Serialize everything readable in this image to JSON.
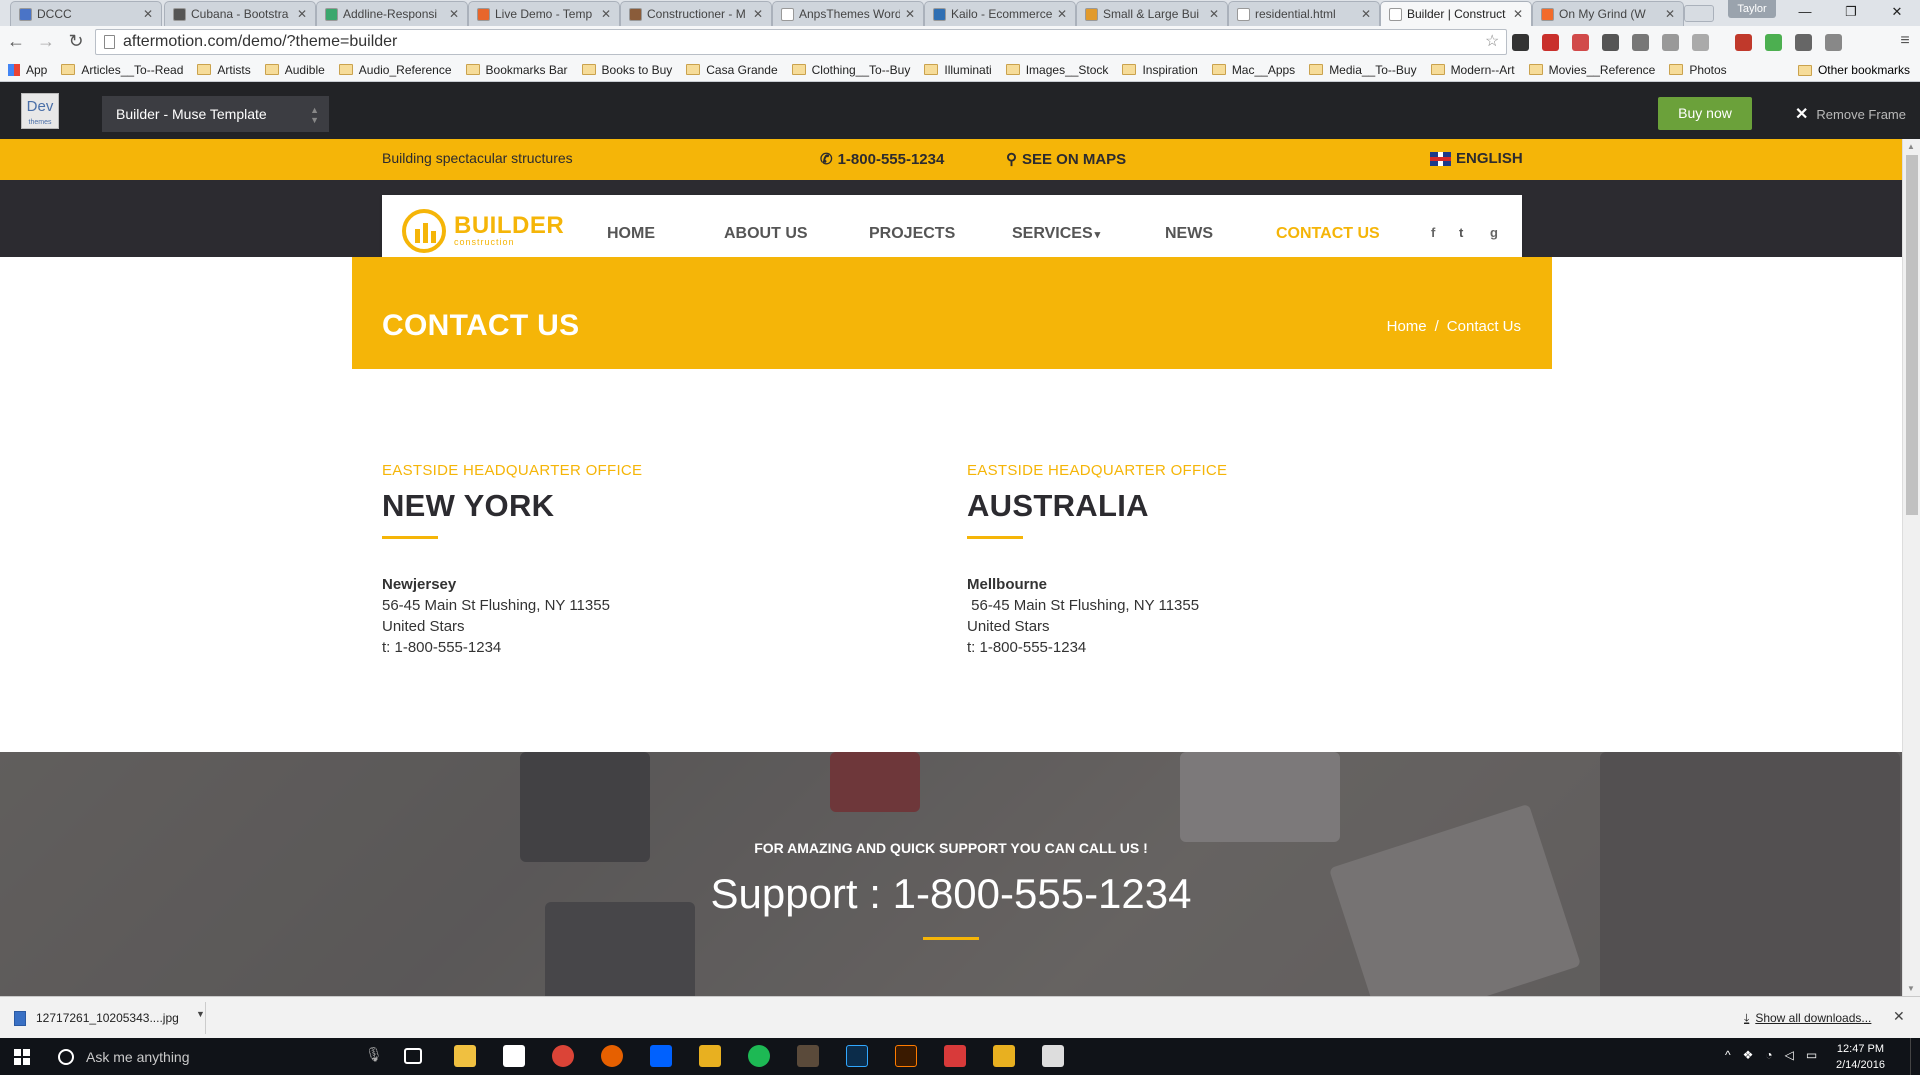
{
  "browser": {
    "tabs": [
      {
        "title": "DCCC",
        "color": "#4a74c7"
      },
      {
        "title": "Cubana - Bootstra",
        "color": "#555555"
      },
      {
        "title": "Addline-Responsi",
        "color": "#3aa76d"
      },
      {
        "title": "Live Demo - Temp",
        "color": "#e8662b"
      },
      {
        "title": "Constructioner - M",
        "color": "#8a5c3a"
      },
      {
        "title": "AnpsThemes Word",
        "color": "#ffffff"
      },
      {
        "title": "Kailo - Ecommerce",
        "color": "#2f6fb3"
      },
      {
        "title": "Small & Large Bui",
        "color": "#e19a2c"
      },
      {
        "title": "residential.html",
        "color": "#ffffff"
      },
      {
        "title": "Builder | Construct",
        "color": "#ffffff"
      },
      {
        "title": "On My Grind (W",
        "color": "#f26b2a"
      }
    ],
    "user": "Taylor",
    "url": "aftermotion.com/demo/?theme=builder",
    "bookmarks": [
      "App",
      "Articles__To--Read",
      "Artists",
      "Audible",
      "Audio_Reference",
      "Bookmarks Bar",
      "Books to Buy",
      "Casa Grande",
      "Clothing__To--Buy",
      "Illuminati",
      "Images__Stock",
      "Inspiration",
      "Mac__Apps",
      "Media__To--Buy",
      "Modern--Art",
      "Movies__Reference",
      "Photos"
    ],
    "other_bookmarks": "Other bookmarks"
  },
  "framebar": {
    "logo_text": "Dev",
    "logo_sub": "themes",
    "theme_select": "Builder - Muse Template",
    "buy_now": "Buy now",
    "remove_frame": "Remove Frame"
  },
  "site": {
    "topstrip": {
      "tagline": "Building spectacular structures",
      "phone": "1-800-555-1234",
      "maps": "SEE ON MAPS",
      "language": "ENGLISH"
    },
    "logo": {
      "name": "BUILDER",
      "sub": "construction"
    },
    "menu": [
      "HOME",
      "ABOUT US",
      "PROJECTS",
      "SERVICES",
      "NEWS",
      "CONTACT US"
    ],
    "services_caret": "▾",
    "social": [
      "f",
      "t",
      "g"
    ],
    "page_title": "CONTACT US",
    "breadcrumb": {
      "home": "Home",
      "sep": "/",
      "current": "Contact Us"
    },
    "offices": [
      {
        "kicker": "EASTSIDE HEADQUARTER OFFICE",
        "city": "NEW YORK",
        "name": "Newjersey",
        "street": "56-45 Main St Flushing, NY 11355",
        "country": "United Stars",
        "phone": "t: 1-800-555-1234"
      },
      {
        "kicker": "EASTSIDE HEADQUARTER OFFICE",
        "city": "AUSTRALIA",
        "name": "Mellbourne",
        "street": " 56-45 Main St Flushing, NY 11355",
        "country": "United Stars",
        "phone": "t: 1-800-555-1234"
      }
    ],
    "support": {
      "lead": "FOR AMAZING AND QUICK SUPPORT YOU CAN CALL US !",
      "big": "Support : 1-800-555-1234"
    }
  },
  "downloads": {
    "file": "12717261_10205343....jpg",
    "show_all": "Show all downloads..."
  },
  "taskbar": {
    "search_placeholder": "Ask me anything",
    "time": "12:47 PM",
    "date": "2/14/2016"
  }
}
